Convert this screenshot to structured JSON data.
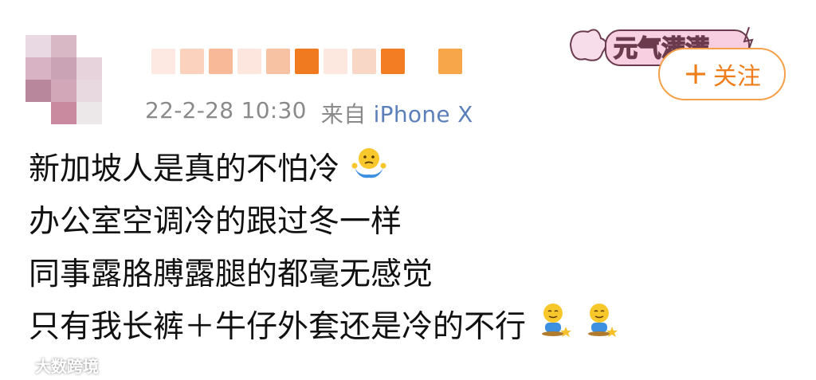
{
  "post": {
    "timestamp": "22-2-28 10:30",
    "source": "来自",
    "device": "iPhone X",
    "lines": [
      "新加坡人是真的不怕冷",
      "办公室空调冷的跟过冬一样",
      "同事露胳膊露腿的都毫无感觉",
      "只有我长裤＋牛仔外套还是冷的不行"
    ],
    "emojis": {
      "line1": "shrug-emoji",
      "line4": [
        "sitting-emoji",
        "sitting-emoji"
      ]
    }
  },
  "badge": {
    "text": "元气满满"
  },
  "follow": {
    "plus": "+",
    "label": "关注"
  },
  "watermark": {
    "text": "大数跨境"
  },
  "colors": {
    "accent": "#ee7d1a",
    "link": "#5b7fb8",
    "meta": "#8a8a8a"
  }
}
